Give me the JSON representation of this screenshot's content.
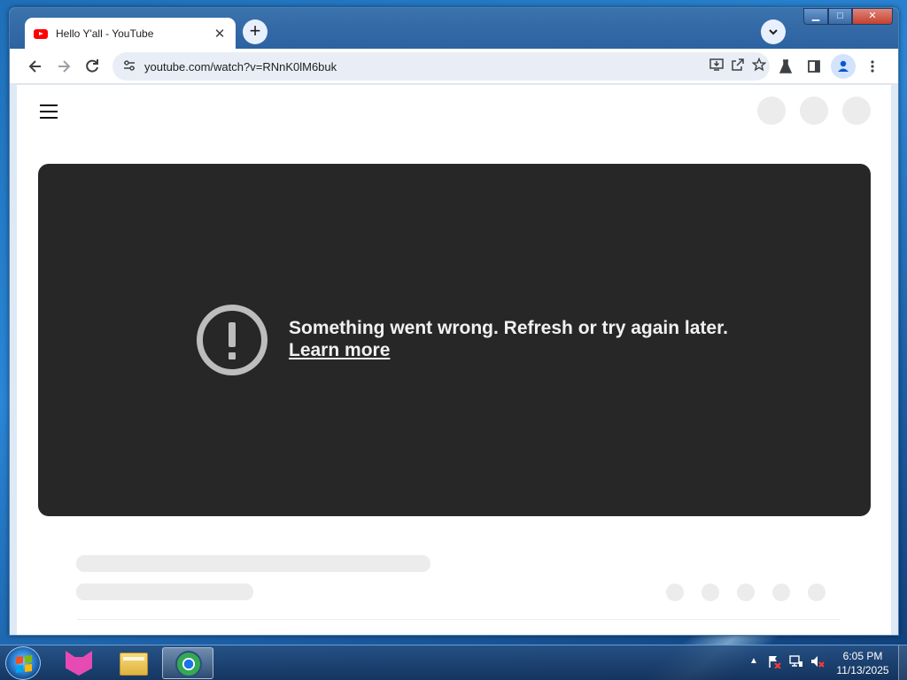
{
  "browser": {
    "tab_title": "Hello Y'all - YouTube",
    "tab_close": "✕",
    "new_tab": "+",
    "url": "youtube.com/watch?v=RNnK0lM6buk",
    "icons": {
      "back": "back-arrow-icon",
      "forward": "forward-arrow-icon",
      "reload": "reload-icon",
      "site_info": "tune-icon",
      "install": "install-app-icon",
      "share": "share-icon",
      "bookmark": "star-icon",
      "labs": "flask-icon",
      "side_panel": "side-panel-icon",
      "profile": "profile-icon",
      "menu": "kebab-menu-icon"
    }
  },
  "window_controls": {
    "minimize": "▁",
    "maximize": "□",
    "close": "✕"
  },
  "page": {
    "error_message": "Something went wrong. Refresh or try again later.",
    "learn_more": "Learn more"
  },
  "taskbar": {
    "time": "6:05 PM",
    "date": "11/13/2025",
    "apps": [
      "fox-app-icon",
      "file-explorer-icon",
      "browser-icon"
    ],
    "tray_icons": [
      "show-hidden-icons-arrow",
      "action-center-flag-icon",
      "network-icon",
      "volume-muted-icon"
    ]
  },
  "colors": {
    "player_bg": "#272727",
    "error_icon": "#bdbdbd",
    "skeleton": "#ececec",
    "youtube_red": "#ff0000"
  }
}
